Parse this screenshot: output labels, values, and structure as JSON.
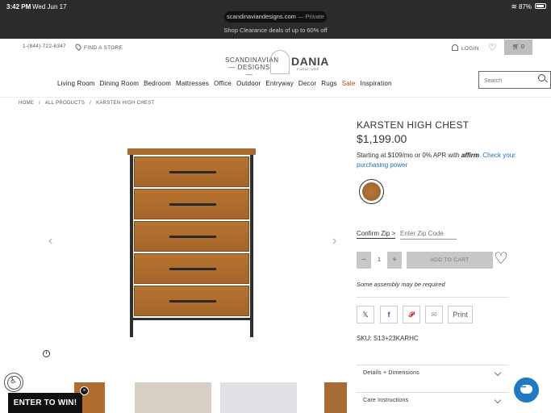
{
  "status_bar": {
    "time": "3:42 PM",
    "date": "Wed Jun 17",
    "battery": "87%"
  },
  "browser": {
    "url": "scandinaviandesigns.com",
    "mode": " — Private"
  },
  "promo_banner": "Shop Clearance deals of up to 60% off",
  "header": {
    "phone": "1-(844)-722-6347",
    "find_store": "FIND A STORE",
    "logo_left_line1": "SCANDINAVIAN",
    "logo_left_line2": "— DESIGNS —",
    "logo_right": "DANIA",
    "logo_right_sub": "FURNITURE",
    "login": "LOGIN",
    "cart_count": "0"
  },
  "nav": {
    "items": [
      "Living Room",
      "Dining Room",
      "Bedroom",
      "Mattresses",
      "Office",
      "Outdoor",
      "Entryway",
      "Decor",
      "Rugs",
      "Sale",
      "Inspiration"
    ]
  },
  "search": {
    "placeholder": "Search"
  },
  "breadcrumb": [
    "HOME",
    "/",
    "ALL PRODUCTS",
    "/",
    "KARSTEN HIGH CHEST"
  ],
  "product": {
    "title": "KARSTEN HIGH CHEST",
    "price": "$1,199.00",
    "finance_text": "Starting at $109/mo or 0% APR with ",
    "finance_brand": "affirm",
    "finance_link": ". Check your purchasing power",
    "confirm_zip": "Confirm Zip >",
    "zip_placeholder": "Enter Zip Code",
    "quantity": "1",
    "qty_minus": "−",
    "qty_plus": "+",
    "add_to_cart": "ADD TO CART",
    "assembly_note": "Some assembly may be required",
    "print_label": "Print",
    "sku": "SKU: S13+23KARHC",
    "swatch_color": "#a86a2f"
  },
  "share_icons": [
    "x-icon",
    "facebook-icon",
    "pinterest-icon",
    "email-icon"
  ],
  "accordions": [
    {
      "label": "Details + Dimensions"
    },
    {
      "label": "Care Instructions"
    }
  ],
  "gallery": {
    "drawer_count": 5,
    "prev_glyph": "‹",
    "next_glyph": "›",
    "info_glyph": "i"
  },
  "popups": {
    "enter_to_win": "ENTER TO WIN!",
    "close_glyph": "×"
  }
}
